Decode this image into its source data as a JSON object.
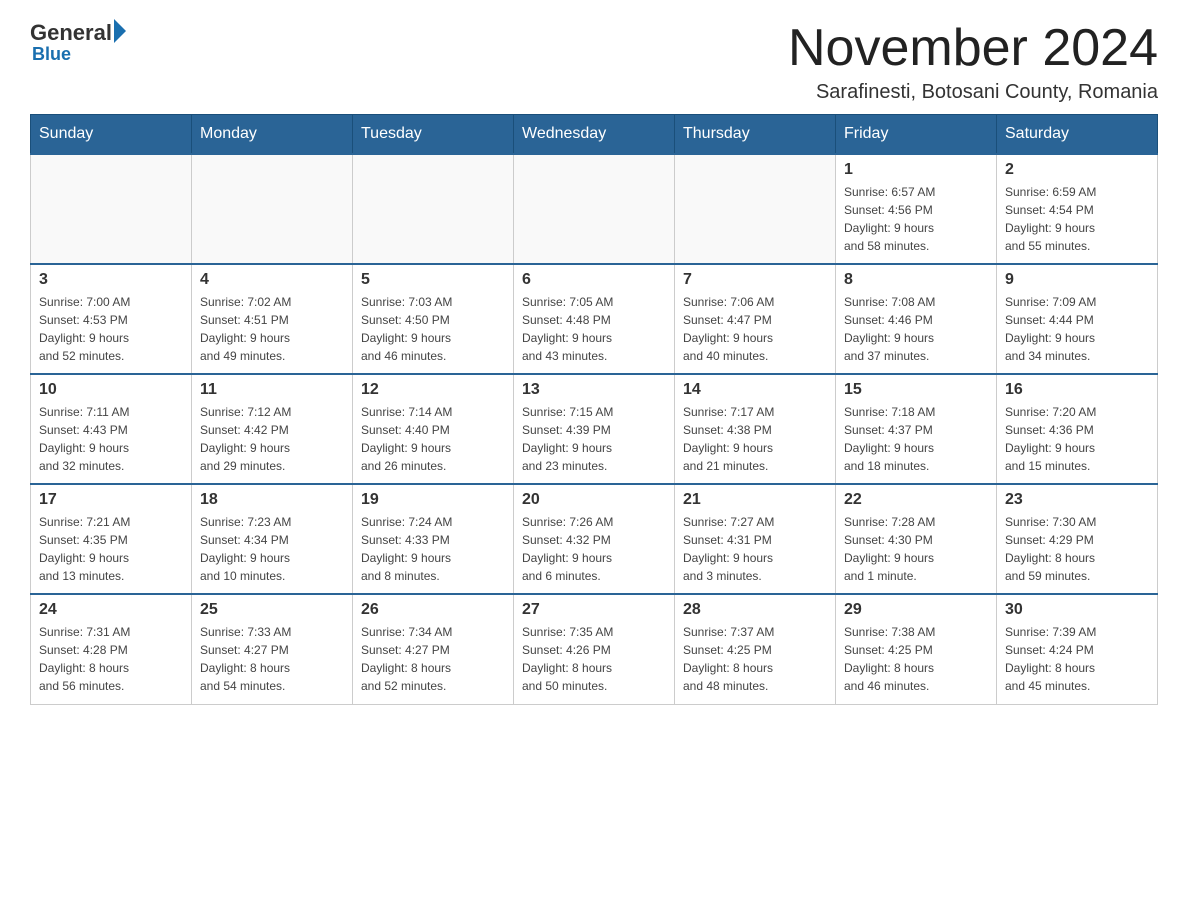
{
  "logo": {
    "general": "General",
    "blue": "Blue"
  },
  "header": {
    "title": "November 2024",
    "subtitle": "Sarafinesti, Botosani County, Romania"
  },
  "days_of_week": [
    "Sunday",
    "Monday",
    "Tuesday",
    "Wednesday",
    "Thursday",
    "Friday",
    "Saturday"
  ],
  "weeks": [
    [
      {
        "day": "",
        "info": ""
      },
      {
        "day": "",
        "info": ""
      },
      {
        "day": "",
        "info": ""
      },
      {
        "day": "",
        "info": ""
      },
      {
        "day": "",
        "info": ""
      },
      {
        "day": "1",
        "info": "Sunrise: 6:57 AM\nSunset: 4:56 PM\nDaylight: 9 hours\nand 58 minutes."
      },
      {
        "day": "2",
        "info": "Sunrise: 6:59 AM\nSunset: 4:54 PM\nDaylight: 9 hours\nand 55 minutes."
      }
    ],
    [
      {
        "day": "3",
        "info": "Sunrise: 7:00 AM\nSunset: 4:53 PM\nDaylight: 9 hours\nand 52 minutes."
      },
      {
        "day": "4",
        "info": "Sunrise: 7:02 AM\nSunset: 4:51 PM\nDaylight: 9 hours\nand 49 minutes."
      },
      {
        "day": "5",
        "info": "Sunrise: 7:03 AM\nSunset: 4:50 PM\nDaylight: 9 hours\nand 46 minutes."
      },
      {
        "day": "6",
        "info": "Sunrise: 7:05 AM\nSunset: 4:48 PM\nDaylight: 9 hours\nand 43 minutes."
      },
      {
        "day": "7",
        "info": "Sunrise: 7:06 AM\nSunset: 4:47 PM\nDaylight: 9 hours\nand 40 minutes."
      },
      {
        "day": "8",
        "info": "Sunrise: 7:08 AM\nSunset: 4:46 PM\nDaylight: 9 hours\nand 37 minutes."
      },
      {
        "day": "9",
        "info": "Sunrise: 7:09 AM\nSunset: 4:44 PM\nDaylight: 9 hours\nand 34 minutes."
      }
    ],
    [
      {
        "day": "10",
        "info": "Sunrise: 7:11 AM\nSunset: 4:43 PM\nDaylight: 9 hours\nand 32 minutes."
      },
      {
        "day": "11",
        "info": "Sunrise: 7:12 AM\nSunset: 4:42 PM\nDaylight: 9 hours\nand 29 minutes."
      },
      {
        "day": "12",
        "info": "Sunrise: 7:14 AM\nSunset: 4:40 PM\nDaylight: 9 hours\nand 26 minutes."
      },
      {
        "day": "13",
        "info": "Sunrise: 7:15 AM\nSunset: 4:39 PM\nDaylight: 9 hours\nand 23 minutes."
      },
      {
        "day": "14",
        "info": "Sunrise: 7:17 AM\nSunset: 4:38 PM\nDaylight: 9 hours\nand 21 minutes."
      },
      {
        "day": "15",
        "info": "Sunrise: 7:18 AM\nSunset: 4:37 PM\nDaylight: 9 hours\nand 18 minutes."
      },
      {
        "day": "16",
        "info": "Sunrise: 7:20 AM\nSunset: 4:36 PM\nDaylight: 9 hours\nand 15 minutes."
      }
    ],
    [
      {
        "day": "17",
        "info": "Sunrise: 7:21 AM\nSunset: 4:35 PM\nDaylight: 9 hours\nand 13 minutes."
      },
      {
        "day": "18",
        "info": "Sunrise: 7:23 AM\nSunset: 4:34 PM\nDaylight: 9 hours\nand 10 minutes."
      },
      {
        "day": "19",
        "info": "Sunrise: 7:24 AM\nSunset: 4:33 PM\nDaylight: 9 hours\nand 8 minutes."
      },
      {
        "day": "20",
        "info": "Sunrise: 7:26 AM\nSunset: 4:32 PM\nDaylight: 9 hours\nand 6 minutes."
      },
      {
        "day": "21",
        "info": "Sunrise: 7:27 AM\nSunset: 4:31 PM\nDaylight: 9 hours\nand 3 minutes."
      },
      {
        "day": "22",
        "info": "Sunrise: 7:28 AM\nSunset: 4:30 PM\nDaylight: 9 hours\nand 1 minute."
      },
      {
        "day": "23",
        "info": "Sunrise: 7:30 AM\nSunset: 4:29 PM\nDaylight: 8 hours\nand 59 minutes."
      }
    ],
    [
      {
        "day": "24",
        "info": "Sunrise: 7:31 AM\nSunset: 4:28 PM\nDaylight: 8 hours\nand 56 minutes."
      },
      {
        "day": "25",
        "info": "Sunrise: 7:33 AM\nSunset: 4:27 PM\nDaylight: 8 hours\nand 54 minutes."
      },
      {
        "day": "26",
        "info": "Sunrise: 7:34 AM\nSunset: 4:27 PM\nDaylight: 8 hours\nand 52 minutes."
      },
      {
        "day": "27",
        "info": "Sunrise: 7:35 AM\nSunset: 4:26 PM\nDaylight: 8 hours\nand 50 minutes."
      },
      {
        "day": "28",
        "info": "Sunrise: 7:37 AM\nSunset: 4:25 PM\nDaylight: 8 hours\nand 48 minutes."
      },
      {
        "day": "29",
        "info": "Sunrise: 7:38 AM\nSunset: 4:25 PM\nDaylight: 8 hours\nand 46 minutes."
      },
      {
        "day": "30",
        "info": "Sunrise: 7:39 AM\nSunset: 4:24 PM\nDaylight: 8 hours\nand 45 minutes."
      }
    ]
  ]
}
